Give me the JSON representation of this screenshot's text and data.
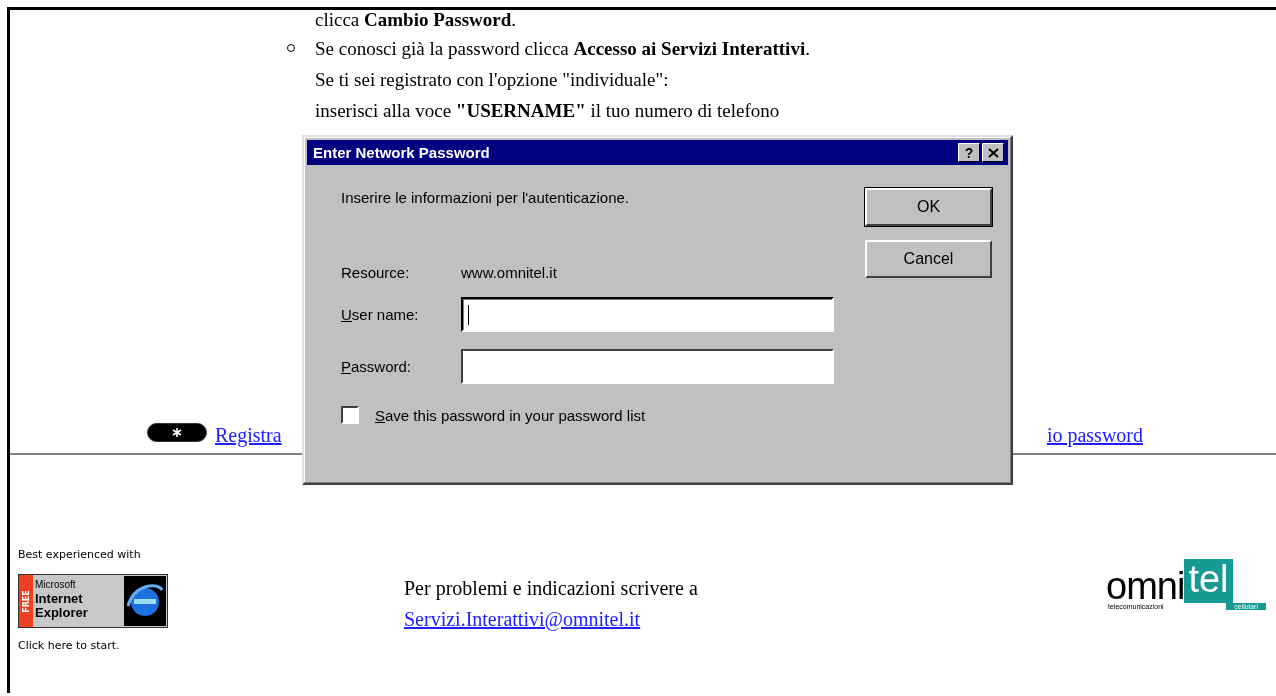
{
  "instructions": [
    {
      "kind": "text",
      "text": "clicca **Cambio Password**."
    },
    {
      "kind": "bullet",
      "text": "Se conosci già la password clicca **Accesso ai Servizi Interattivi**."
    },
    {
      "kind": "text",
      "text": "Se ti sei registrato con l'opzione \"individuale\":"
    },
    {
      "kind": "text",
      "text": "inserisci alla voce **\"USERNAME\"** il tuo numero di telefono"
    }
  ],
  "nav_links": [
    {
      "text": "Registra"
    },
    {
      "text": "io password"
    }
  ],
  "footer": {
    "browser_note": "Best experienced with",
    "badge": {
      "tag": "FREE",
      "lines": [
        "Microsoft",
        "Internet",
        "Explorer"
      ]
    },
    "start_note": "Click here to start.",
    "contact_text": "Per problemi e indicazioni scrivere a",
    "contact_email": "Servizi.Interattivi@omnitel.it",
    "logo": {
      "wordmark_left": "omni",
      "wordmark_right": "tel",
      "tagline_left": "telecomunicazioni",
      "tagline_right": "cellulari"
    }
  },
  "dialog": {
    "title": "Enter Network Password",
    "help_button": "?",
    "message": "Inserire le informazioni per l'autenticazione.",
    "resource_label": "Resource:",
    "resource_value": "www.omnitel.it",
    "fields": [
      {
        "label": "User name:",
        "focused": true
      },
      {
        "label": "Password:",
        "focused": false
      }
    ],
    "save_option": {
      "label": "Save this password in your password list",
      "checked": false
    },
    "buttons": [
      {
        "label": "OK",
        "default": true
      },
      {
        "label": "Cancel",
        "default": false
      }
    ]
  }
}
